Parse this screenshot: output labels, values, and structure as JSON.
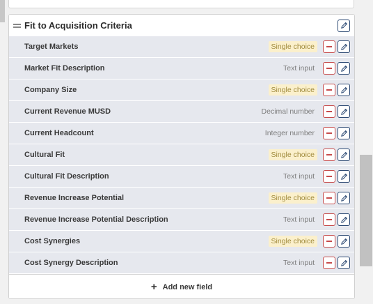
{
  "section": {
    "title": "Fit to Acquisition Criteria"
  },
  "fields": [
    {
      "label": "Target Markets",
      "type": "Single choice",
      "kind": "choice"
    },
    {
      "label": "Market Fit Description",
      "type": "Text input",
      "kind": "plain"
    },
    {
      "label": "Company Size",
      "type": "Single choice",
      "kind": "choice"
    },
    {
      "label": "Current Revenue MUSD",
      "type": "Decimal number",
      "kind": "plain"
    },
    {
      "label": "Current Headcount",
      "type": "Integer number",
      "kind": "plain"
    },
    {
      "label": "Cultural Fit",
      "type": "Single choice",
      "kind": "choice"
    },
    {
      "label": "Cultural Fit Description",
      "type": "Text input",
      "kind": "plain"
    },
    {
      "label": "Revenue Increase Potential",
      "type": "Single choice",
      "kind": "choice"
    },
    {
      "label": "Revenue Increase Potential Description",
      "type": "Text input",
      "kind": "plain"
    },
    {
      "label": "Cost Synergies",
      "type": "Single choice",
      "kind": "choice"
    },
    {
      "label": "Cost Synergy Description",
      "type": "Text input",
      "kind": "plain"
    }
  ],
  "footer": {
    "add_label": "Add new field",
    "add_icon": "plus-icon"
  },
  "icons": {
    "edit": "pencil-icon",
    "remove": "minus-icon",
    "drag": "drag-handle-icon"
  },
  "colors": {
    "row_bg": "#e6e8ee",
    "choice_badge_bg": "#fbf0cc",
    "remove_border": "#c64b4b",
    "edit_border": "#2d4a74"
  }
}
